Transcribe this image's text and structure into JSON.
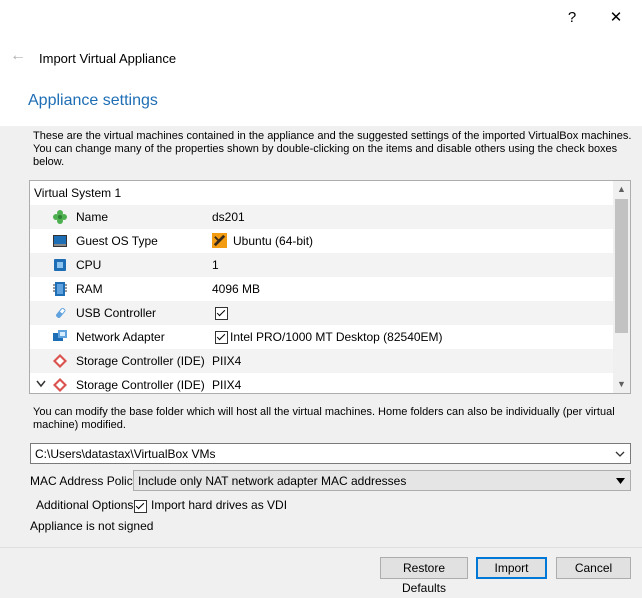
{
  "window": {
    "help_glyph": "?",
    "close_glyph": "✕"
  },
  "header": {
    "back_glyph": "←",
    "title": "Import Virtual Appliance"
  },
  "section": {
    "title": "Appliance settings",
    "description": "These are the virtual machines contained in the appliance and the suggested settings of the imported VirtualBox machines. You can change many of the properties shown by double-clicking on the items and disable others using the check boxes below."
  },
  "tree": {
    "root_label": "Virtual System 1",
    "rows": [
      {
        "label": "Name",
        "value": "ds201",
        "icon": "name-icon"
      },
      {
        "label": "Guest OS Type",
        "value": "Ubuntu (64-bit)",
        "icon": "guest-os-icon"
      },
      {
        "label": "CPU",
        "value": "1",
        "icon": "cpu-icon"
      },
      {
        "label": "RAM",
        "value": "4096 MB",
        "icon": "ram-icon"
      },
      {
        "label": "USB Controller",
        "value": "",
        "icon": "usb-icon"
      },
      {
        "label": "Network Adapter",
        "value": "Intel PRO/1000 MT Desktop (82540EM)",
        "icon": "network-icon"
      },
      {
        "label": "Storage Controller (IDE)",
        "value": "PIIX4",
        "icon": "storage-icon"
      },
      {
        "label": "Storage Controller (IDE)",
        "value": "PIIX4",
        "icon": "storage-icon"
      }
    ]
  },
  "folder": {
    "description": "You can modify the base folder which will host all the virtual machines. Home folders can also be individually (per virtual machine) modified.",
    "path": "C:\\Users\\datastax\\VirtualBox VMs"
  },
  "mac": {
    "label": "MAC Address Policy:",
    "value": "Include only NAT network adapter MAC addresses"
  },
  "options": {
    "label": "Additional Options:",
    "import_vdi_label": "Import hard drives as VDI"
  },
  "status": {
    "signed_text": "Appliance is not signed"
  },
  "buttons": {
    "restore": "Restore Defaults",
    "import": "Import",
    "cancel": "Cancel"
  },
  "colors": {
    "accent": "#0078d7",
    "title_blue": "#1e6eb5"
  }
}
